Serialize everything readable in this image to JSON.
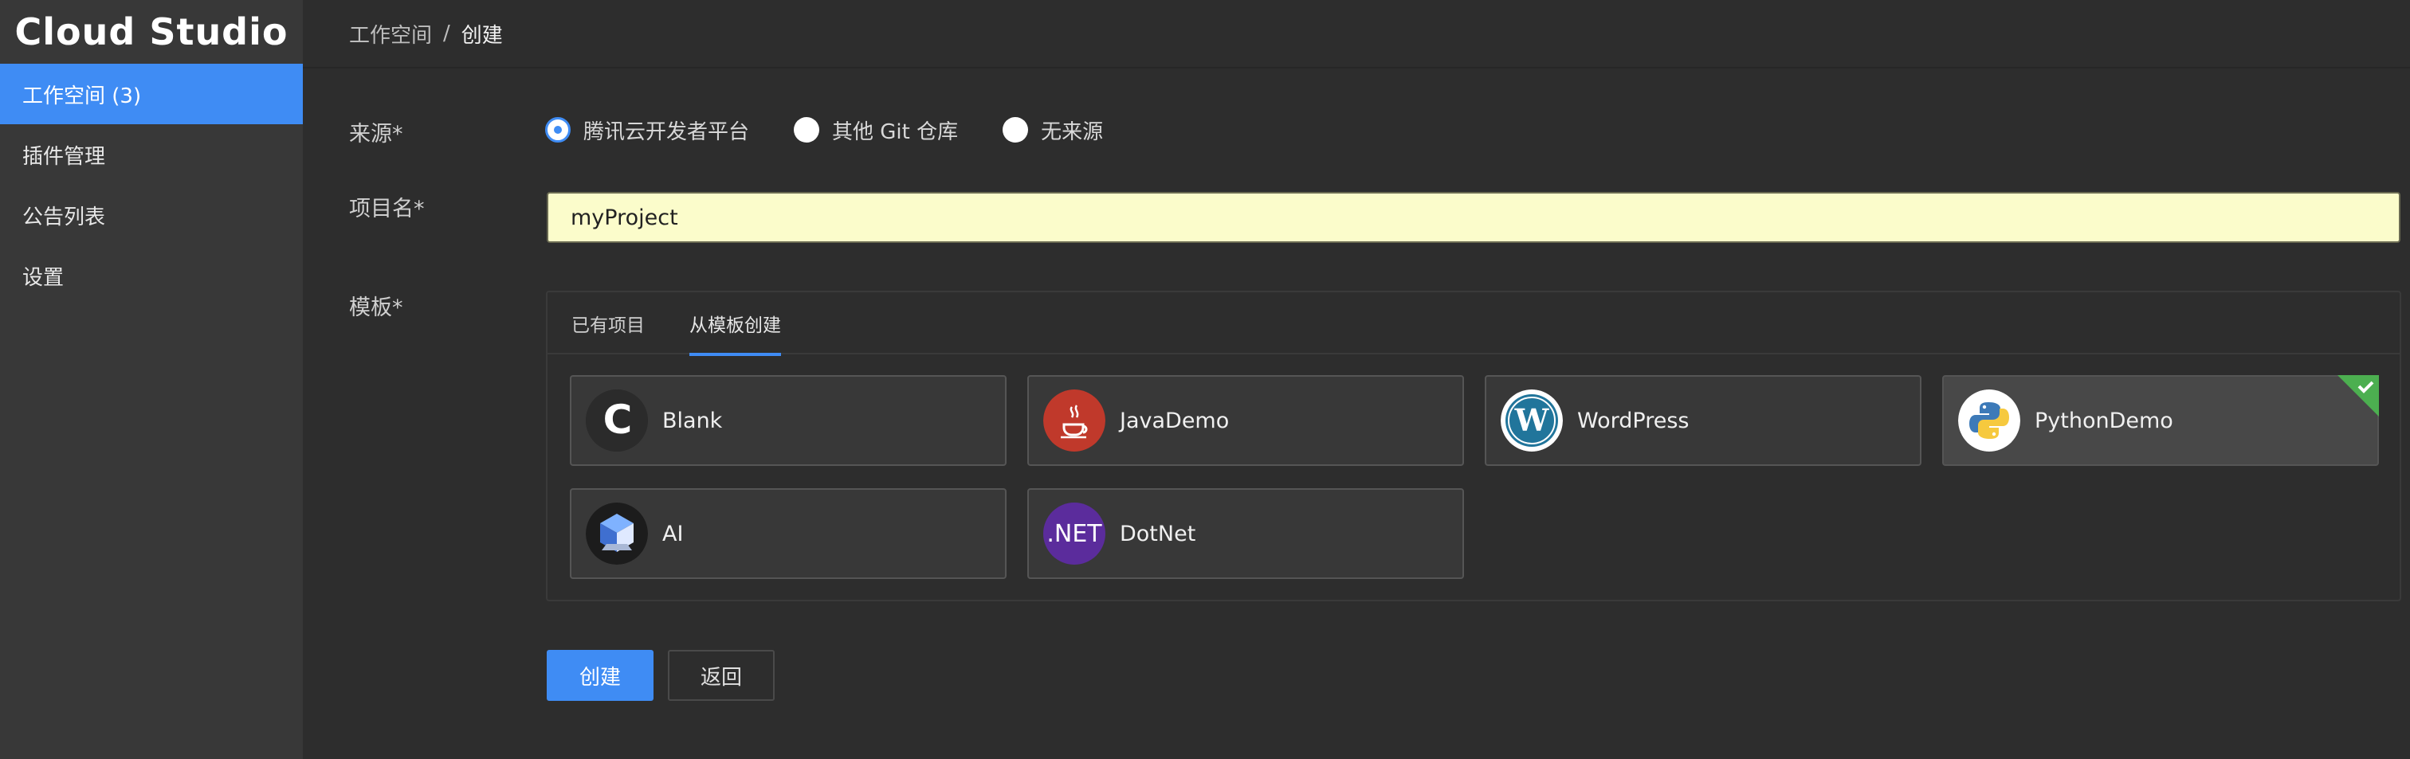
{
  "app": {
    "title": "Cloud Studio"
  },
  "sidebar": {
    "items": [
      {
        "label": "工作空间 (3)",
        "active": true
      },
      {
        "label": "插件管理"
      },
      {
        "label": "公告列表"
      },
      {
        "label": "设置"
      }
    ]
  },
  "breadcrumb": {
    "parent": "工作空间",
    "separator": "/",
    "current": "创建"
  },
  "form": {
    "source": {
      "label": "来源*",
      "options": [
        "腾讯云开发者平台",
        "其他 Git 仓库",
        "无来源"
      ],
      "selected": "腾讯云开发者平台"
    },
    "project_name": {
      "label": "项目名*",
      "value": "myProject"
    },
    "template": {
      "label": "模板*",
      "tabs": [
        {
          "label": "已有项目"
        },
        {
          "label": "从模板创建",
          "active": true
        }
      ],
      "cards": [
        {
          "label": "Blank",
          "icon": "c-letter-icon"
        },
        {
          "label": "JavaDemo",
          "icon": "java-coffee-icon"
        },
        {
          "label": "WordPress",
          "icon": "wordpress-icon"
        },
        {
          "label": "PythonDemo",
          "icon": "python-icon",
          "selected": true
        },
        {
          "label": "AI",
          "icon": "ai-cube-icon"
        },
        {
          "label": "DotNet",
          "icon": "dotnet-icon",
          "icon_text": ".NET"
        }
      ]
    },
    "buttons": {
      "create": "创建",
      "back": "返回"
    }
  },
  "colors": {
    "accent": "#3f8cf4",
    "selected_check": "#4caf50",
    "java": "#c0392b",
    "dotnet": "#5b2c9c"
  }
}
